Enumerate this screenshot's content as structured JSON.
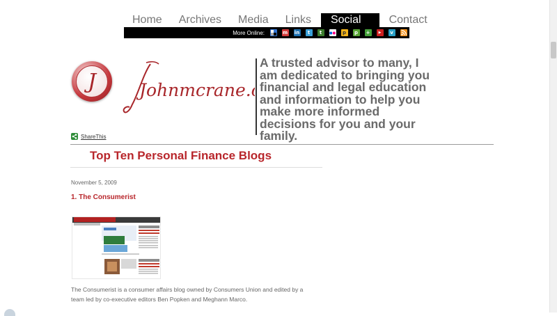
{
  "nav": {
    "items": [
      {
        "label": "Home",
        "active": false
      },
      {
        "label": "Archives",
        "active": false
      },
      {
        "label": "Media",
        "active": false
      },
      {
        "label": "Links",
        "active": false
      },
      {
        "label": "Social",
        "active": true
      },
      {
        "label": "Contact",
        "active": false
      }
    ]
  },
  "social_bar": {
    "more_label": "More Online:",
    "icons": [
      {
        "name": "delicious-icon",
        "color": "#3274d1",
        "glyph": "▪"
      },
      {
        "name": "myspace-icon",
        "color": "#d13a3a",
        "glyph": "m"
      },
      {
        "name": "linkedin-icon",
        "color": "#1c6fb0",
        "glyph": "in"
      },
      {
        "name": "twitter-icon",
        "color": "#3aa0d8",
        "glyph": "t"
      },
      {
        "name": "technorati-icon",
        "color": "#3b7b2c",
        "glyph": "t"
      },
      {
        "name": "flickr-icon",
        "color": "#ff2e8a",
        "glyph": "••"
      },
      {
        "name": "plaxo-icon",
        "color": "#f3b31a",
        "glyph": "p"
      },
      {
        "name": "stumbleupon-icon",
        "color": "#58a534",
        "glyph": "p"
      },
      {
        "name": "plus-icon",
        "color": "#45a03a",
        "glyph": "+"
      },
      {
        "name": "youtube-icon",
        "color": "#cc1f1f",
        "glyph": "▶"
      },
      {
        "name": "vimeo-icon",
        "color": "#2aa1c7",
        "glyph": "v"
      },
      {
        "name": "rss-icon",
        "color": "#f39019",
        "glyph": "))"
      }
    ]
  },
  "header": {
    "logo_letter": "J",
    "logo_text": "Johnmcrane.com",
    "tagline_lines": [
      "A trusted advisor to many, I",
      "am dedicated to bringing you",
      "financial and legal education",
      "and information to help you",
      "make more informed",
      "decisions for you and your",
      "family."
    ]
  },
  "share": {
    "label": "ShareThis"
  },
  "post": {
    "title": "Top Ten Personal Finance Blogs",
    "date": "November 5, 2009",
    "heading": "1. The Consumerist",
    "body_lines": [
      "The Consumerist is a consumer affairs blog owned by Consumers Union and edited by a",
      "team led by co-executive editors Ben Popken and Meghann Marco."
    ]
  },
  "colors": {
    "accent": "#b8262b",
    "nav_text": "#777777",
    "tagline": "#6a6a6a"
  }
}
